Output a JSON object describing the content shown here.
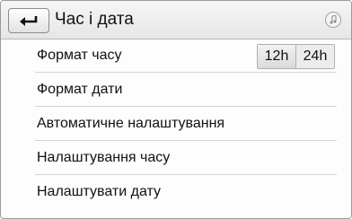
{
  "header": {
    "title": "Час і дата",
    "back_icon": "back-arrow-icon",
    "media_icon": "music-note-icon"
  },
  "settings": {
    "time_format": {
      "label": "Формат часу",
      "options": [
        "12h",
        "24h"
      ],
      "selected": "12h"
    },
    "items": [
      {
        "label": "Формат дати"
      },
      {
        "label": "Автоматичне налаштування"
      },
      {
        "label": "Налаштування часу"
      },
      {
        "label": "Налаштувати дату"
      }
    ]
  }
}
